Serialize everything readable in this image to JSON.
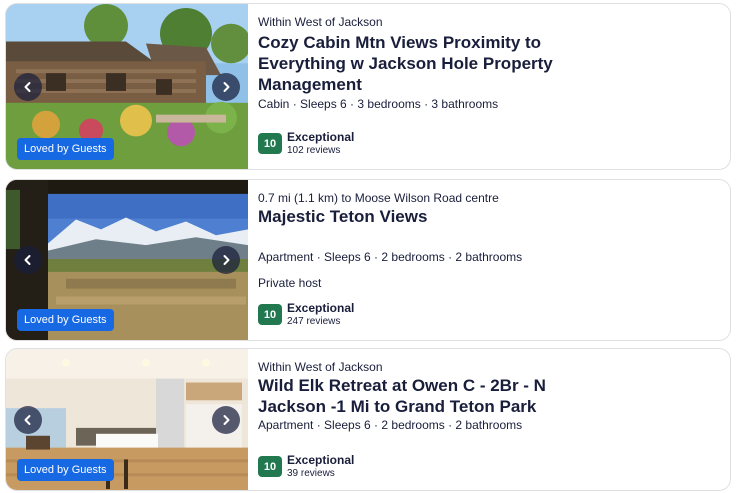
{
  "listings": [
    {
      "location": "Within West of Jackson",
      "title": "Cozy Cabin Mtn Views Proximity to Everything w Jackson Hole Property Management",
      "meta": "Cabin · Sleeps 6 · 3 bedrooms · 3 bathrooms",
      "host": "",
      "badge": "Loved by Guests",
      "score": "10",
      "rating_label": "Exceptional",
      "reviews": "102 reviews"
    },
    {
      "location": "0.7 mi (1.1 km) to Moose Wilson Road centre",
      "title": "Majestic Teton Views",
      "meta": "Apartment · Sleeps 6 · 2 bedrooms · 2 bathrooms",
      "host": "Private host",
      "badge": "Loved by Guests",
      "score": "10",
      "rating_label": "Exceptional",
      "reviews": "247 reviews"
    },
    {
      "location": "Within West of Jackson",
      "title": "Wild Elk Retreat at Owen C - 2Br - N Jackson -1 Mi to Grand Teton Park",
      "meta": "Apartment · Sleeps 6 · 2 bedrooms · 2 bathrooms",
      "host": "",
      "badge": "Loved by Guests",
      "score": "10",
      "rating_label": "Exceptional",
      "reviews": "39 reviews"
    }
  ],
  "colors": {
    "score_green": "#227950",
    "badge_blue": "#1668e3",
    "text_dark": "#191e3b"
  },
  "icons": {
    "prev": "chevron-left-icon",
    "next": "chevron-right-icon"
  }
}
